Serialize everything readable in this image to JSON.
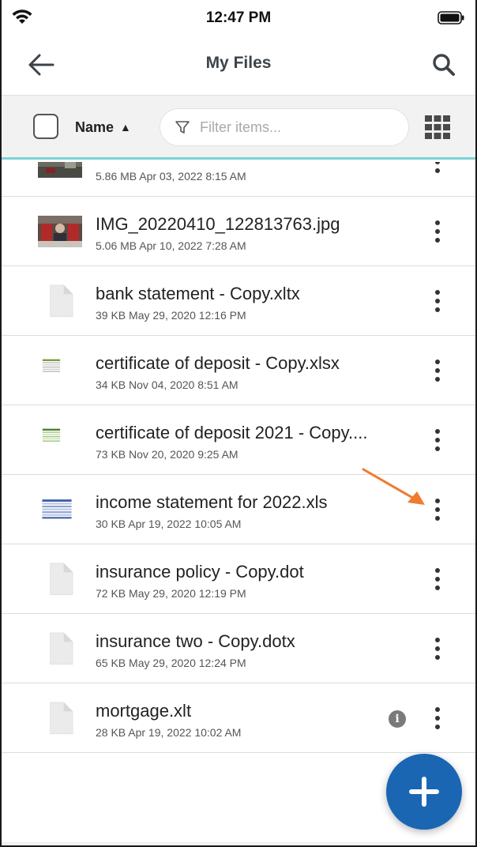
{
  "status_bar": {
    "time": "12:47 PM"
  },
  "header": {
    "title": "My Files",
    "back_icon": "arrow-left-icon",
    "search_icon": "search-icon"
  },
  "toolbar": {
    "sort_label": "Name",
    "sort_direction": "ascending",
    "filter_placeholder": "Filter items...",
    "filter_value": ""
  },
  "files": [
    {
      "name": "",
      "meta": "5.86 MB Apr 03, 2022 8:15 AM",
      "thumb": "photo"
    },
    {
      "name": "IMG_20220410_122813763.jpg",
      "meta": "5.06 MB Apr 10, 2022 7:28 AM",
      "thumb": "photo"
    },
    {
      "name": "bank statement - Copy.xltx",
      "meta": "39 KB May 29, 2020 12:16 PM",
      "thumb": "doc"
    },
    {
      "name": "certificate of deposit - Copy.xlsx",
      "meta": "34 KB Nov 04, 2020 8:51 AM",
      "thumb": "sheet"
    },
    {
      "name": "certificate of deposit 2021 - Copy....",
      "meta": "73 KB Nov 20, 2020 9:25 AM",
      "thumb": "sheet-green"
    },
    {
      "name": "income statement for 2022.xls",
      "meta": "30 KB Apr 19, 2022 10:05 AM",
      "thumb": "sheet-blue"
    },
    {
      "name": "insurance policy - Copy.dot",
      "meta": "72 KB May 29, 2020 12:19 PM",
      "thumb": "doc"
    },
    {
      "name": "insurance two - Copy.dotx",
      "meta": "65 KB May 29, 2020 12:24 PM",
      "thumb": "doc"
    },
    {
      "name": "mortgage.xlt",
      "meta": "28 KB Apr 19, 2022 10:02 AM",
      "thumb": "doc"
    }
  ],
  "colors": {
    "accent_underline": "#7cd3d6",
    "fab": "#1a66b3",
    "annotation_arrow": "#f07a2e"
  },
  "fab": {
    "icon": "plus-icon"
  }
}
